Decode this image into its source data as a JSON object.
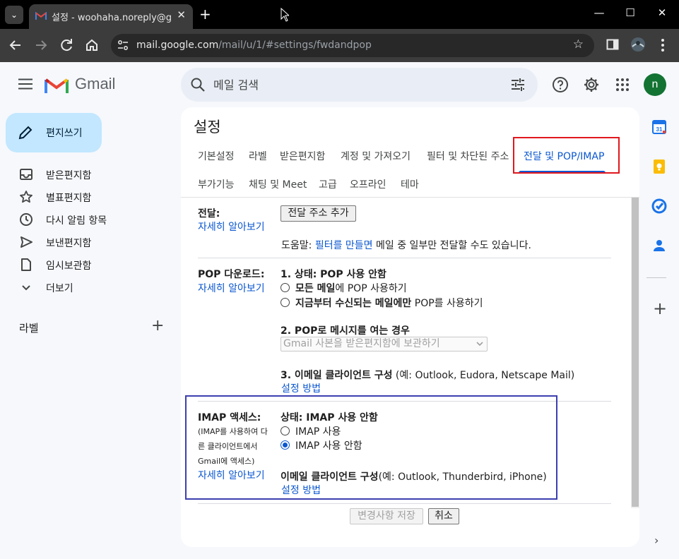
{
  "browser": {
    "tab_title": "설정 - woohaha.noreply@gmail.com",
    "url_host": "mail.google.com",
    "url_path": "/mail/u/1/#settings/fwdandpop",
    "new_tab": "+",
    "win_min": "—",
    "win_max": "☐",
    "win_close": "✕",
    "tab_close": "✕",
    "tab_menu": "⌄",
    "star": "☆"
  },
  "header": {
    "product": "Gmail",
    "search_placeholder": "메일 검색",
    "avatar_initial": "n"
  },
  "nav": {
    "compose": "편지쓰기",
    "items": [
      {
        "label": "받은편지함",
        "icon": "inbox-icon"
      },
      {
        "label": "별표편지함",
        "icon": "star-icon"
      },
      {
        "label": "다시 알림 항목",
        "icon": "clock-icon"
      },
      {
        "label": "보낸편지함",
        "icon": "send-icon"
      },
      {
        "label": "임시보관함",
        "icon": "draft-icon"
      },
      {
        "label": "더보기",
        "icon": "chevron-down-icon"
      }
    ],
    "labels_heading": "라벨",
    "labels_add": "+"
  },
  "settings": {
    "title": "설정",
    "tabs_row1": [
      "기본설정",
      "라벨",
      "받은편지함",
      "계정 및 가져오기",
      "필터 및 차단된 주소",
      "전달 및 POP/IMAP"
    ],
    "tabs_row2": [
      "부가기능",
      "채팅 및 Meet",
      "고급",
      "오프라인",
      "테마"
    ],
    "active_tab": "전달 및 POP/IMAP",
    "forwarding": {
      "label": "전달:",
      "learn_more": "자세히 알아보기",
      "add_button": "전달 주소 추가",
      "tip_prefix": "도움말: ",
      "tip_link": "필터를 만들면",
      "tip_suffix": " 메일 중 일부만 전달할 수도 있습니다."
    },
    "pop": {
      "label": "POP 다운로드:",
      "learn_more": "자세히 알아보기",
      "status": "1. 상태: POP 사용 안함",
      "option_all_bold": "모든 메일",
      "option_all_rest": "에 POP 사용하기",
      "option_new_bold": "지금부터 수신되는 메일에만",
      "option_new_rest": " POP를 사용하기",
      "access_heading": "2. POP로 메시지를 여는 경우",
      "access_select": "Gmail 사본을 받은편지함에 보관하기",
      "client_heading": "3. 이메일 클라이언트 구성",
      "client_examples": " (예: Outlook, Eudora, Netscape Mail)",
      "setup_link": "설정 방법"
    },
    "imap": {
      "label": "IMAP 액세스:",
      "note_line1": "(IMAP를 사용하여 다",
      "note_line2": "른 클라이언트에서",
      "note_line3": "Gmail에 액세스)",
      "learn_more": "자세히 알아보기",
      "status": "상태: IMAP 사용 안함",
      "option_on": "IMAP 사용",
      "option_off": "IMAP 사용 안함",
      "selected": "IMAP 사용 안함",
      "client_heading": "이메일 클라이언트 구성",
      "client_examples": "(예: Outlook, Thunderbird, iPhone)",
      "setup_link": "설정 방법"
    },
    "save_button": "변경사항 저장",
    "cancel_button": "취소"
  }
}
